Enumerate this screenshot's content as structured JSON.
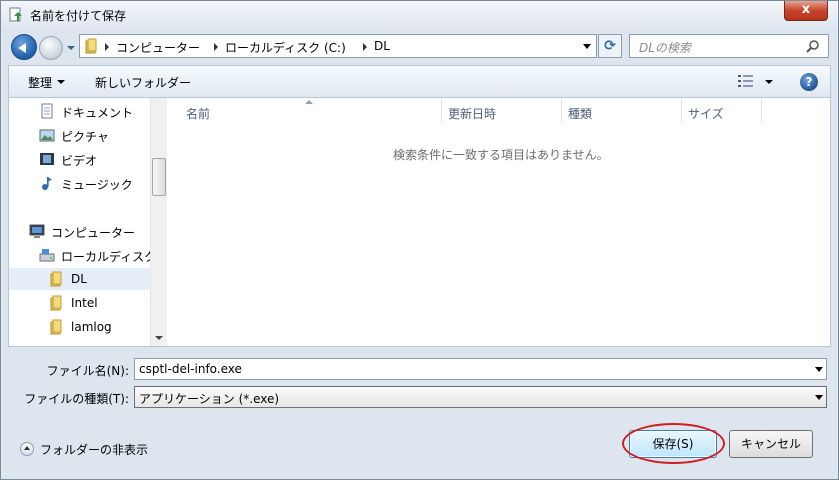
{
  "window": {
    "title": "名前を付けて保存",
    "close_label": "x"
  },
  "address": {
    "breadcrumbs": [
      "コンピューター",
      "ローカルディスク (C:)",
      "DL"
    ],
    "search_placeholder": "DLの検索"
  },
  "toolbar": {
    "organize_label": "整理",
    "new_folder_label": "新しいフォルダー",
    "help_label": "?"
  },
  "navigation": {
    "items": [
      {
        "label": "ドキュメント",
        "icon": "document-icon"
      },
      {
        "label": "ピクチャ",
        "icon": "picture-icon"
      },
      {
        "label": "ビデオ",
        "icon": "video-icon"
      },
      {
        "label": "ミュージック",
        "icon": "music-icon"
      },
      {
        "label": "コンピューター",
        "icon": "computer-icon"
      },
      {
        "label": "ローカルディスク",
        "icon": "drive-icon"
      },
      {
        "label": "DL",
        "icon": "folder-icon",
        "selected": true
      },
      {
        "label": "Intel",
        "icon": "folder-icon"
      },
      {
        "label": "lamlog",
        "icon": "folder-icon"
      }
    ]
  },
  "file_list": {
    "columns": [
      "名前",
      "更新日時",
      "種類",
      "サイズ"
    ],
    "empty_message": "検索条件に一致する項目はありません。"
  },
  "form": {
    "filename_label": "ファイル名(N):",
    "filename_value": "csptl-del-info.exe",
    "filetype_label": "ファイルの種類(T):",
    "filetype_value": "アプリケーション (*.exe)"
  },
  "footer": {
    "hide_folders_label": "フォルダーの非表示",
    "save_label": "保存(S)",
    "cancel_label": "キャンセル"
  },
  "colors": {
    "annotation_circle": "#d11f1f",
    "window_background": "#dde6ef"
  }
}
